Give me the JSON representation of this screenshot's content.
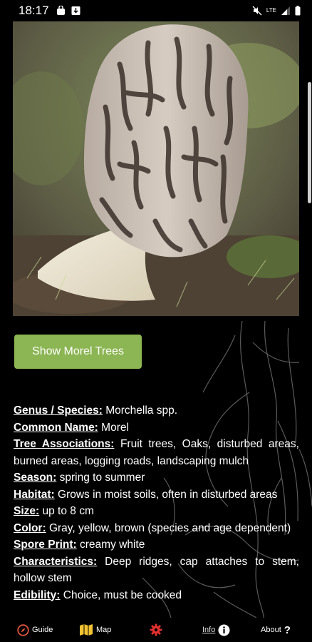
{
  "status_bar": {
    "time": "18:17",
    "network": "LTE"
  },
  "button": {
    "label": "Show Morel Trees"
  },
  "details": [
    {
      "label": "Genus / Species:",
      "value": "Morchella spp."
    },
    {
      "label": "Common Name:",
      "value": "Morel"
    },
    {
      "label": "Tree Associations:",
      "value": "Fruit trees, Oaks, disturbed areas, burned areas, logging roads, landscaping mulch"
    },
    {
      "label": "Season:",
      "value": "spring to summer"
    },
    {
      "label": "Habitat:",
      "value": "Grows in moist soils, often in disturbed areas"
    },
    {
      "label": "Size:",
      "value": "up to 8 cm"
    },
    {
      "label": "Color:",
      "value": "Gray, yellow, brown (species and age dependent)"
    },
    {
      "label": "Spore Print:",
      "value": "creamy white"
    },
    {
      "label": "Characteristics:",
      "value": "Deep ridges, cap attaches to stem, hollow stem"
    },
    {
      "label": "Edibility:",
      "value": "Choice, must be cooked"
    }
  ],
  "tabs": [
    {
      "label": "Guide",
      "icon": "compass-icon",
      "color": "#e0543c"
    },
    {
      "label": "Map",
      "icon": "map-icon",
      "color": "#f1c232"
    },
    {
      "label": "",
      "icon": "gear-icon",
      "color": "#e3302f"
    },
    {
      "label": "Info",
      "icon": "info-icon",
      "color": "#ffffff",
      "active": true
    },
    {
      "label": "About",
      "icon": "question-icon",
      "color": "#ffffff"
    }
  ],
  "colors": {
    "button_green": "#8cb553",
    "background": "#000000"
  }
}
